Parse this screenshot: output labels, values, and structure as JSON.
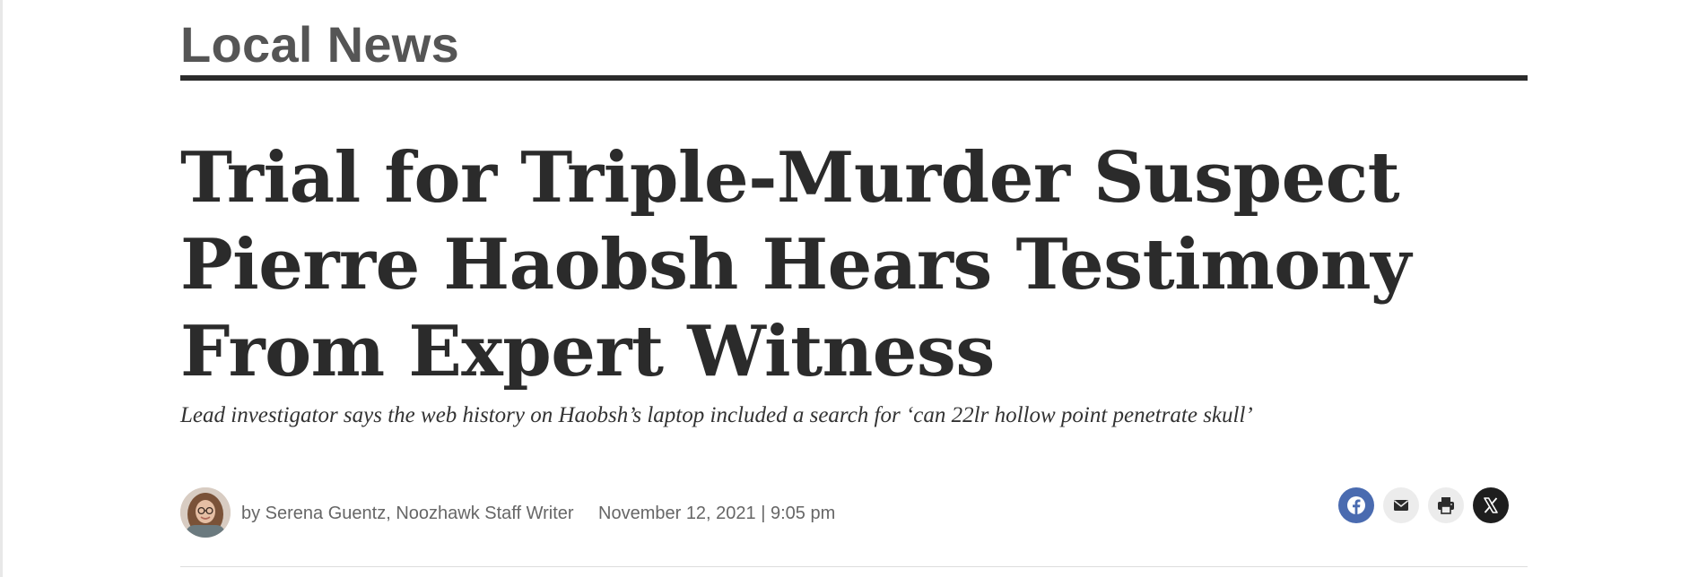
{
  "section": {
    "label": "Local News"
  },
  "article": {
    "headline": "Trial for Triple-Murder Suspect Pierre Haobsh Hears Testimony From Expert Witness",
    "subhead": "Lead investigator says the web history on Haobsh’s laptop included a search for ‘can 22lr hollow point penetrate skull’",
    "byline": "by Serena Guentz, Noozhawk Staff Writer",
    "dateline": "November 12, 2021 | 9:05 pm"
  },
  "share": [
    {
      "icon": "facebook-icon",
      "color": "#4a6bb0"
    },
    {
      "icon": "email-icon",
      "color": "#ececec"
    },
    {
      "icon": "print-icon",
      "color": "#ececec"
    },
    {
      "icon": "x-icon",
      "color": "#1e1e1e"
    }
  ],
  "colors": {
    "section_label": "#555555",
    "headline": "#2b2b2b",
    "meta_text": "#666666",
    "rule": "#2b2b2b"
  }
}
